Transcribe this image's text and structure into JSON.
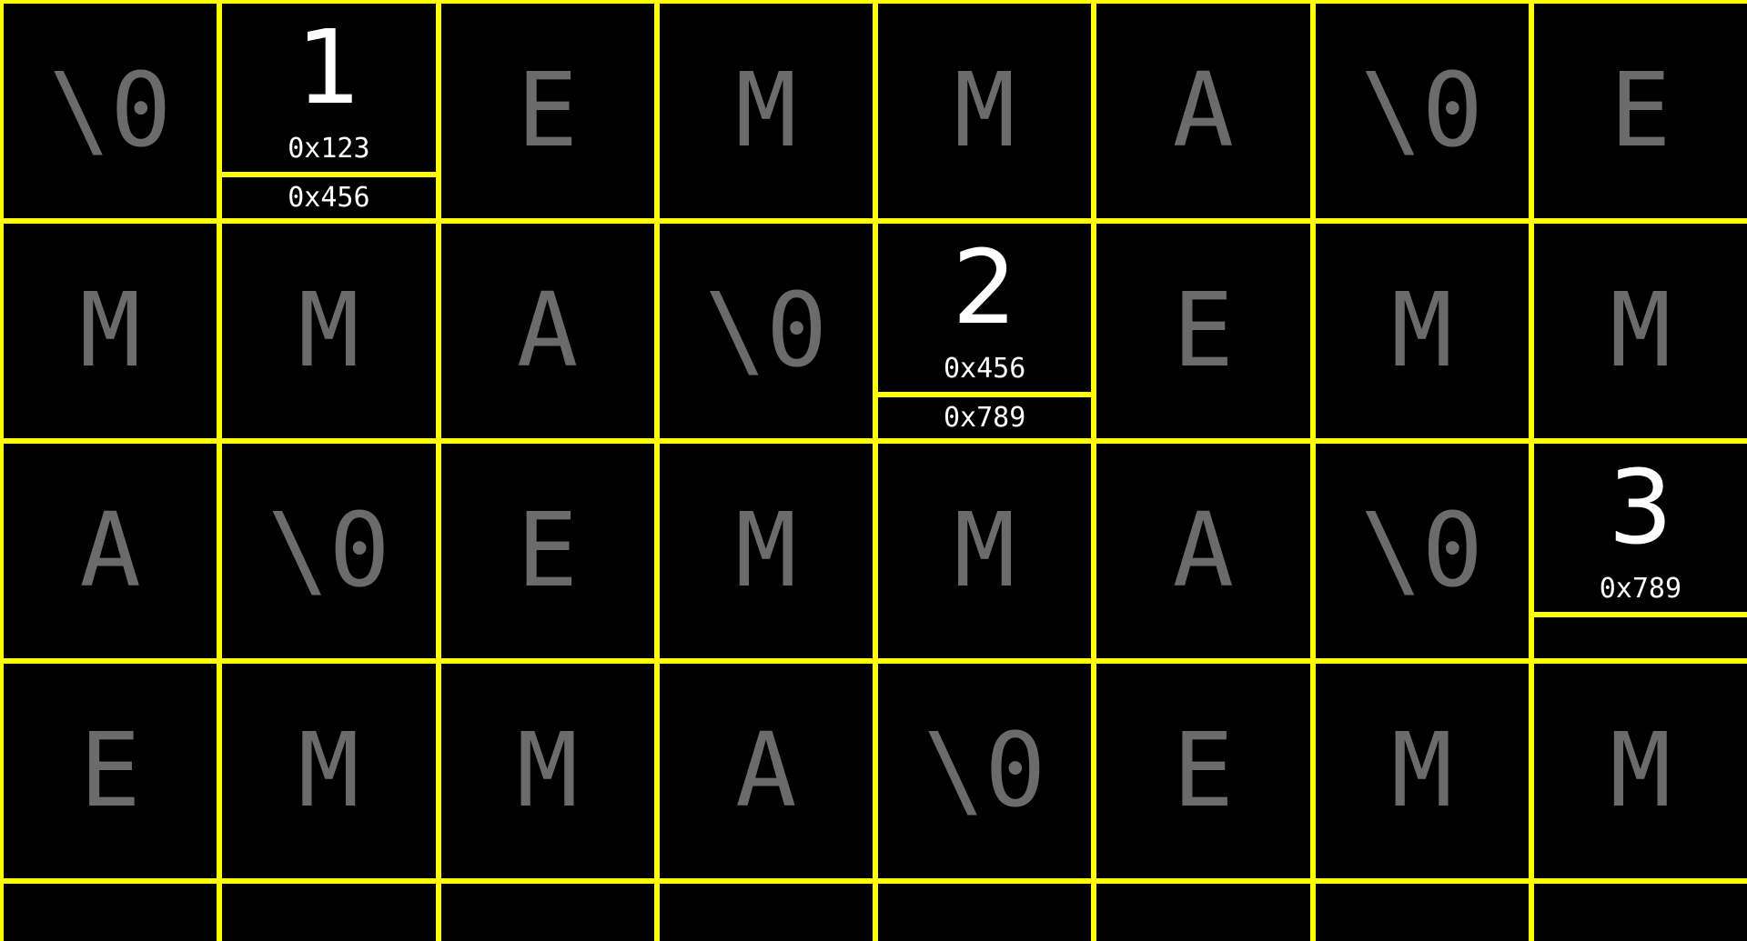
{
  "colors": {
    "background": "#000000",
    "grid_lines": "#ffff00",
    "char_text": "#6b6b6b",
    "node_text": "#ffffff"
  },
  "grid": {
    "columns": 8,
    "rows": [
      [
        "\\0",
        "NODE:0",
        "E",
        "M",
        "M",
        "A",
        "\\0",
        "E"
      ],
      [
        "M",
        "M",
        "A",
        "\\0",
        "NODE:1",
        "E",
        "M",
        "M"
      ],
      [
        "A",
        "\\0",
        "E",
        "M",
        "M",
        "A",
        "\\0",
        "NODE:2"
      ],
      [
        "E",
        "M",
        "M",
        "A",
        "\\0",
        "E",
        "M",
        "M"
      ],
      [
        "",
        "",
        "",
        "",
        "",
        "",
        "",
        ""
      ]
    ]
  },
  "nodes": [
    {
      "index": "1",
      "address": "0x123",
      "next": "0x456"
    },
    {
      "index": "2",
      "address": "0x456",
      "next": "0x789"
    },
    {
      "index": "3",
      "address": "0x789",
      "next": ""
    }
  ]
}
